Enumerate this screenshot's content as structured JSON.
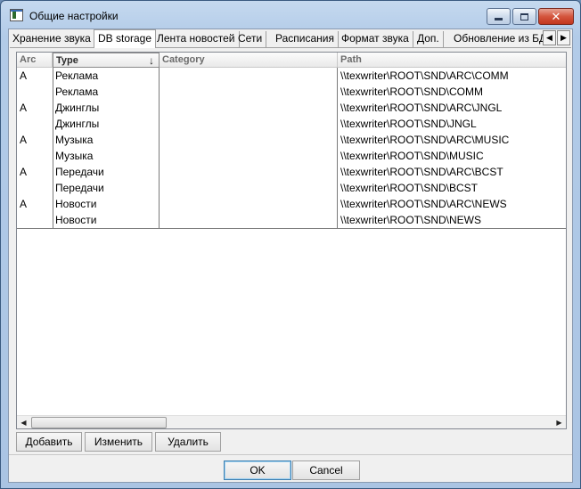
{
  "window": {
    "title": "Общие настройки",
    "close_glyph": "✕"
  },
  "tabs": [
    {
      "label": "Хранение звука"
    },
    {
      "label": "DB storage",
      "active": true
    },
    {
      "label": "Лента новостей"
    },
    {
      "label": "Сети"
    },
    {
      "label": "Расписания"
    },
    {
      "label": "Формат звука"
    },
    {
      "label": "Доп."
    },
    {
      "label": "Обновление из БД"
    }
  ],
  "tab_scroll": {
    "left": "◀",
    "right": "▶"
  },
  "grid": {
    "columns": [
      "Arc",
      "Type",
      "Category",
      "Path"
    ],
    "sort_indicator": "↓",
    "rows": [
      {
        "arc": "A",
        "type": "Реклама",
        "category": "",
        "path": "\\\\texwriter\\ROOT\\SND\\ARC\\COMM"
      },
      {
        "arc": "",
        "type": "Реклама",
        "category": "",
        "path": "\\\\texwriter\\ROOT\\SND\\COMM"
      },
      {
        "arc": "A",
        "type": "Джинглы",
        "category": "",
        "path": "\\\\texwriter\\ROOT\\SND\\ARC\\JNGL"
      },
      {
        "arc": "",
        "type": "Джинглы",
        "category": "",
        "path": "\\\\texwriter\\ROOT\\SND\\JNGL"
      },
      {
        "arc": "A",
        "type": "Музыка",
        "category": "",
        "path": "\\\\texwriter\\ROOT\\SND\\ARC\\MUSIC"
      },
      {
        "arc": "",
        "type": "Музыка",
        "category": "",
        "path": "\\\\texwriter\\ROOT\\SND\\MUSIC"
      },
      {
        "arc": "A",
        "type": "Передачи",
        "category": "",
        "path": "\\\\texwriter\\ROOT\\SND\\ARC\\BCST"
      },
      {
        "arc": "",
        "type": "Передачи",
        "category": "",
        "path": "\\\\texwriter\\ROOT\\SND\\BCST"
      },
      {
        "arc": "A",
        "type": "Новости",
        "category": "",
        "path": "\\\\texwriter\\ROOT\\SND\\ARC\\NEWS"
      },
      {
        "arc": "",
        "type": "Новости",
        "category": "",
        "path": "\\\\texwriter\\ROOT\\SND\\NEWS"
      }
    ]
  },
  "scrollbar": {
    "left": "◀",
    "right": "▶"
  },
  "actions": {
    "add": "Добавить",
    "edit": "Изменить",
    "delete": "Удалить"
  },
  "dialog": {
    "ok": "OK",
    "cancel": "Cancel"
  }
}
